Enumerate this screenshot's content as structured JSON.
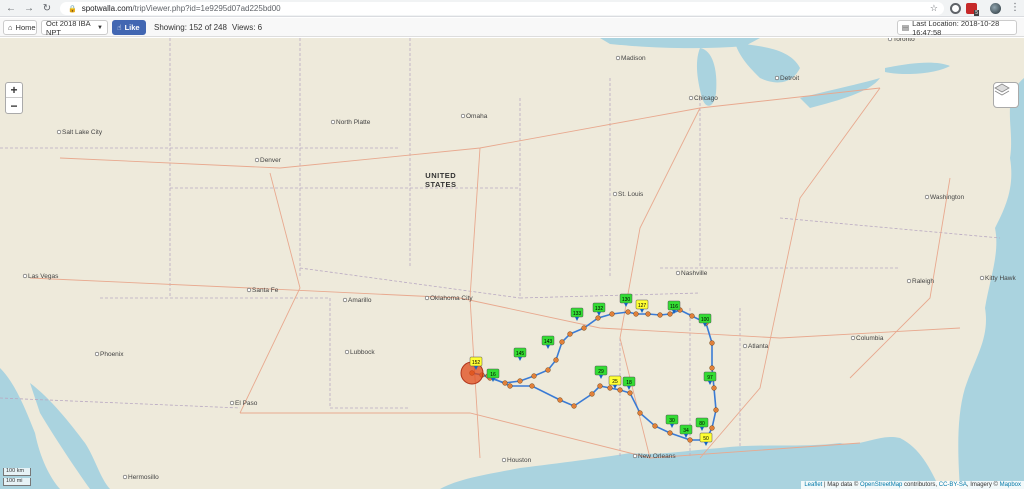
{
  "browser": {
    "url_domain": "spotwalla.com",
    "url_path": "/tripViewer.php?id=1e9295d07ad225bd00",
    "back_icon": "arrow-left-icon",
    "forward_icon": "arrow-right-icon",
    "reload_icon": "reload-icon",
    "extension_badge": "5"
  },
  "toolbar": {
    "home_label": "Home",
    "trip_label": "Oct 2018 IBA NPT",
    "like_label": "Like",
    "showing_text": "Showing: 152 of 248",
    "views_text": "Views: 6",
    "last_location_text": "Last Location: 2018-10-28 16:47:58"
  },
  "map": {
    "zoom_in": "+",
    "zoom_out": "−",
    "scale_km": "100 km",
    "scale_mi": "100 mi",
    "country_label_1": "UNITED",
    "country_label_2": "STATES",
    "attribution": {
      "leaflet": "Leaflet",
      "map_data": "| Map data ©",
      "osm": "OpenStreetMap",
      "contributors": "contributors,",
      "license": "CC-BY-SA",
      "imagery": ", Imagery ©",
      "mapbox": "Mapbox"
    },
    "cities": [
      {
        "name": "Toronto"
      },
      {
        "name": "Madison"
      },
      {
        "name": "Detroit"
      },
      {
        "name": "Chicago"
      },
      {
        "name": "Salt Lake City"
      },
      {
        "name": "North Platte"
      },
      {
        "name": "Omaha"
      },
      {
        "name": "Denver"
      },
      {
        "name": "St. Louis"
      },
      {
        "name": "Washington"
      },
      {
        "name": "Las Vegas"
      },
      {
        "name": "Santa Fe"
      },
      {
        "name": "Amarillo"
      },
      {
        "name": "Oklahoma City"
      },
      {
        "name": "Nashville"
      },
      {
        "name": "Raleigh"
      },
      {
        "name": "Kitty Hawk"
      },
      {
        "name": "Phoenix"
      },
      {
        "name": "Lubbock"
      },
      {
        "name": "Atlanta"
      },
      {
        "name": "Columbia"
      },
      {
        "name": "El Paso"
      },
      {
        "name": "Houston"
      },
      {
        "name": "New Orleans"
      },
      {
        "name": "Hermosillo"
      }
    ],
    "markers": [
      {
        "label": "152",
        "color": "#ffff33"
      },
      {
        "label": "145",
        "color": "#33dd33"
      },
      {
        "label": "143",
        "color": "#33dd33"
      },
      {
        "label": "133",
        "color": "#33dd33"
      },
      {
        "label": "132",
        "color": "#33dd33"
      },
      {
        "label": "130",
        "color": "#33dd33"
      },
      {
        "label": "127",
        "color": "#ffff33"
      },
      {
        "label": "116",
        "color": "#33dd33"
      },
      {
        "label": "100",
        "color": "#33dd33"
      },
      {
        "label": "97",
        "color": "#33dd33"
      },
      {
        "label": "80",
        "color": "#33dd33"
      },
      {
        "label": "50",
        "color": "#ffff33"
      },
      {
        "label": "34",
        "color": "#33dd33"
      },
      {
        "label": "30",
        "color": "#33dd33"
      },
      {
        "label": "29",
        "color": "#33dd33"
      },
      {
        "label": "25",
        "color": "#ffff33"
      },
      {
        "label": "18",
        "color": "#33dd33"
      },
      {
        "label": "16",
        "color": "#33dd33"
      }
    ],
    "colors": {
      "route": "#3a7bd5",
      "waypoint": "#e0803a",
      "current": "#e04a1a",
      "water": "#aad3df",
      "land": "#eeeadb"
    }
  }
}
